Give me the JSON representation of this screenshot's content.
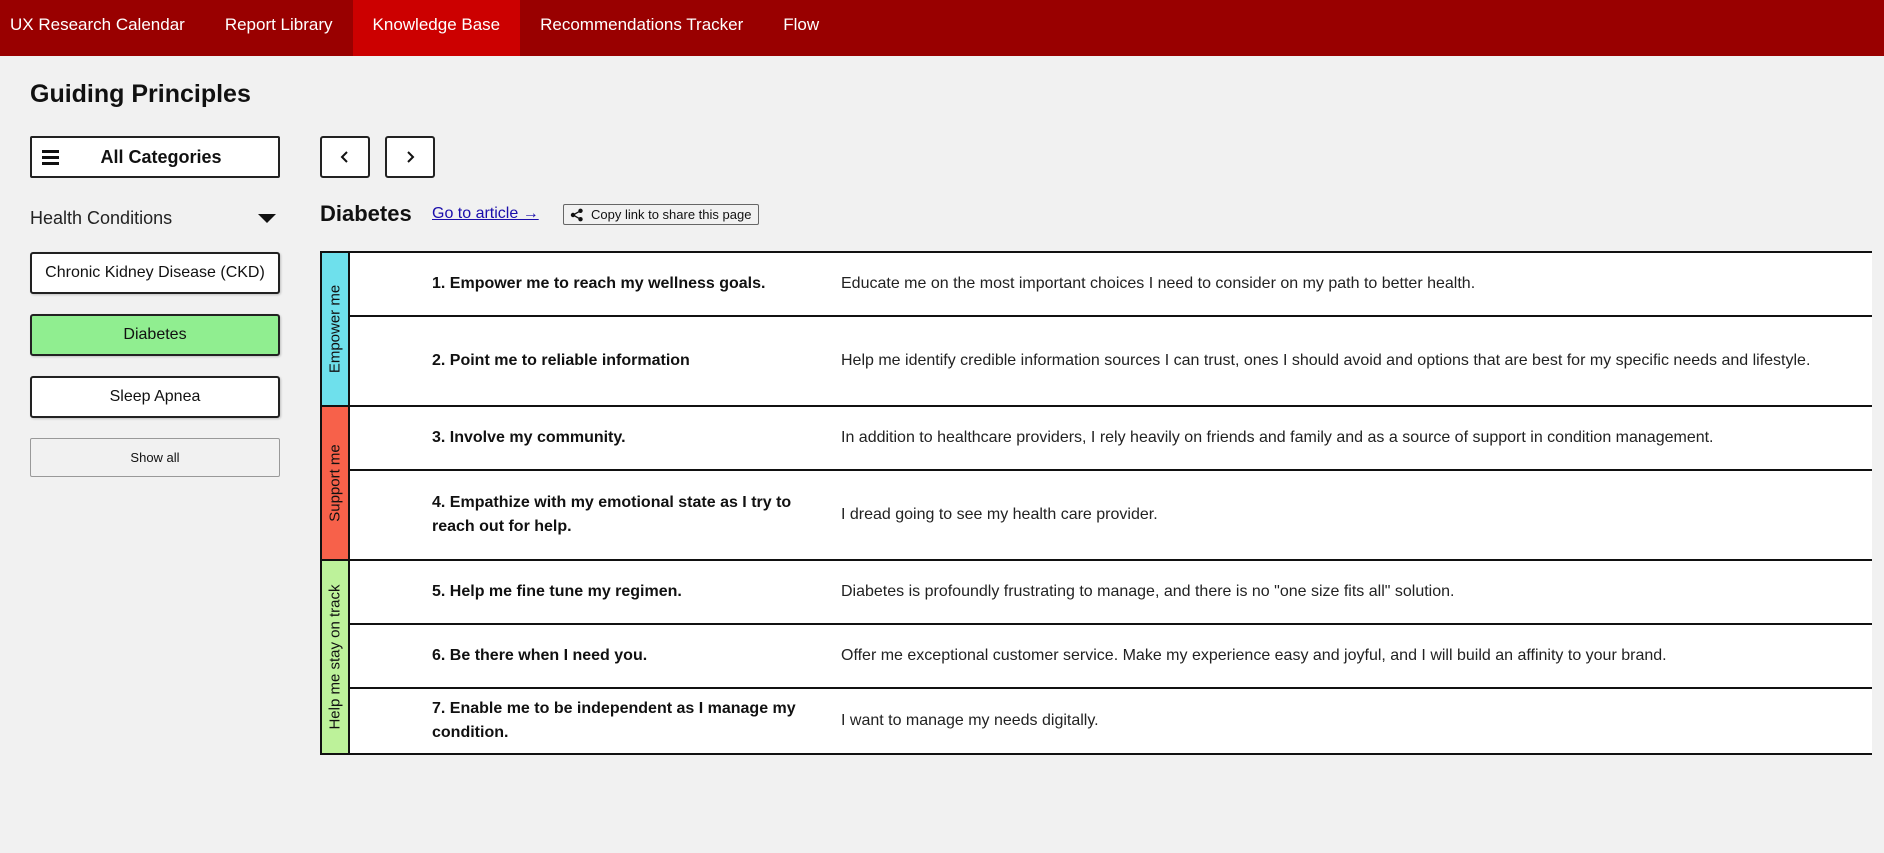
{
  "nav": [
    {
      "label": "UX Research Calendar",
      "active": false
    },
    {
      "label": "Report Library",
      "active": false
    },
    {
      "label": "Knowledge Base",
      "active": true
    },
    {
      "label": "Recommendations Tracker",
      "active": false
    },
    {
      "label": "Flow",
      "active": false
    }
  ],
  "page_title": "Guiding Principles",
  "sidebar": {
    "all_categories_label": "All Categories",
    "category_label": "Health Conditions",
    "conditions": [
      {
        "label": "Chronic Kidney Disease (CKD)",
        "selected": false
      },
      {
        "label": "Diabetes",
        "selected": true
      },
      {
        "label": "Sleep Apnea",
        "selected": false
      }
    ],
    "show_all_label": "Show all"
  },
  "main": {
    "title": "Diabetes",
    "article_link": "Go to article →",
    "copy_link": "Copy link to share this page"
  },
  "principles": {
    "groups": [
      {
        "label": "Empower me",
        "color": "#6ee0ec",
        "rows": [
          {
            "title": "1. Empower me to reach my wellness goals.",
            "desc": "Educate me on the most important choices I need to consider on my path to better health."
          },
          {
            "title": "2. Point me to reliable information",
            "desc": "Help me identify credible information sources I can trust, ones I should avoid and options that are best for my specific needs and lifestyle."
          }
        ]
      },
      {
        "label": "Support me",
        "color": "#f7614a",
        "rows": [
          {
            "title": "3. Involve my community.",
            "desc": "In addition to healthcare providers, I rely heavily on friends and family and as a source of support in condition management."
          },
          {
            "title": "4. Empathize with my emotional state as I try to reach out for help.",
            "desc": "I dread going to see my health care provider."
          }
        ]
      },
      {
        "label": "Help me stay on track",
        "color": "#bdf29a",
        "rows": [
          {
            "title": "5. Help me fine tune my regimen.",
            "desc": "Diabetes is profoundly frustrating to manage, and there is no \"one size fits all\" solution."
          },
          {
            "title": "6. Be there when I need you.",
            "desc": "Offer me exceptional customer service. Make my experience easy and joyful, and I will build an affinity to your brand."
          },
          {
            "title": "7. Enable me to be independent as I manage my condition.",
            "desc": "I want to manage my needs digitally."
          }
        ]
      }
    ]
  }
}
